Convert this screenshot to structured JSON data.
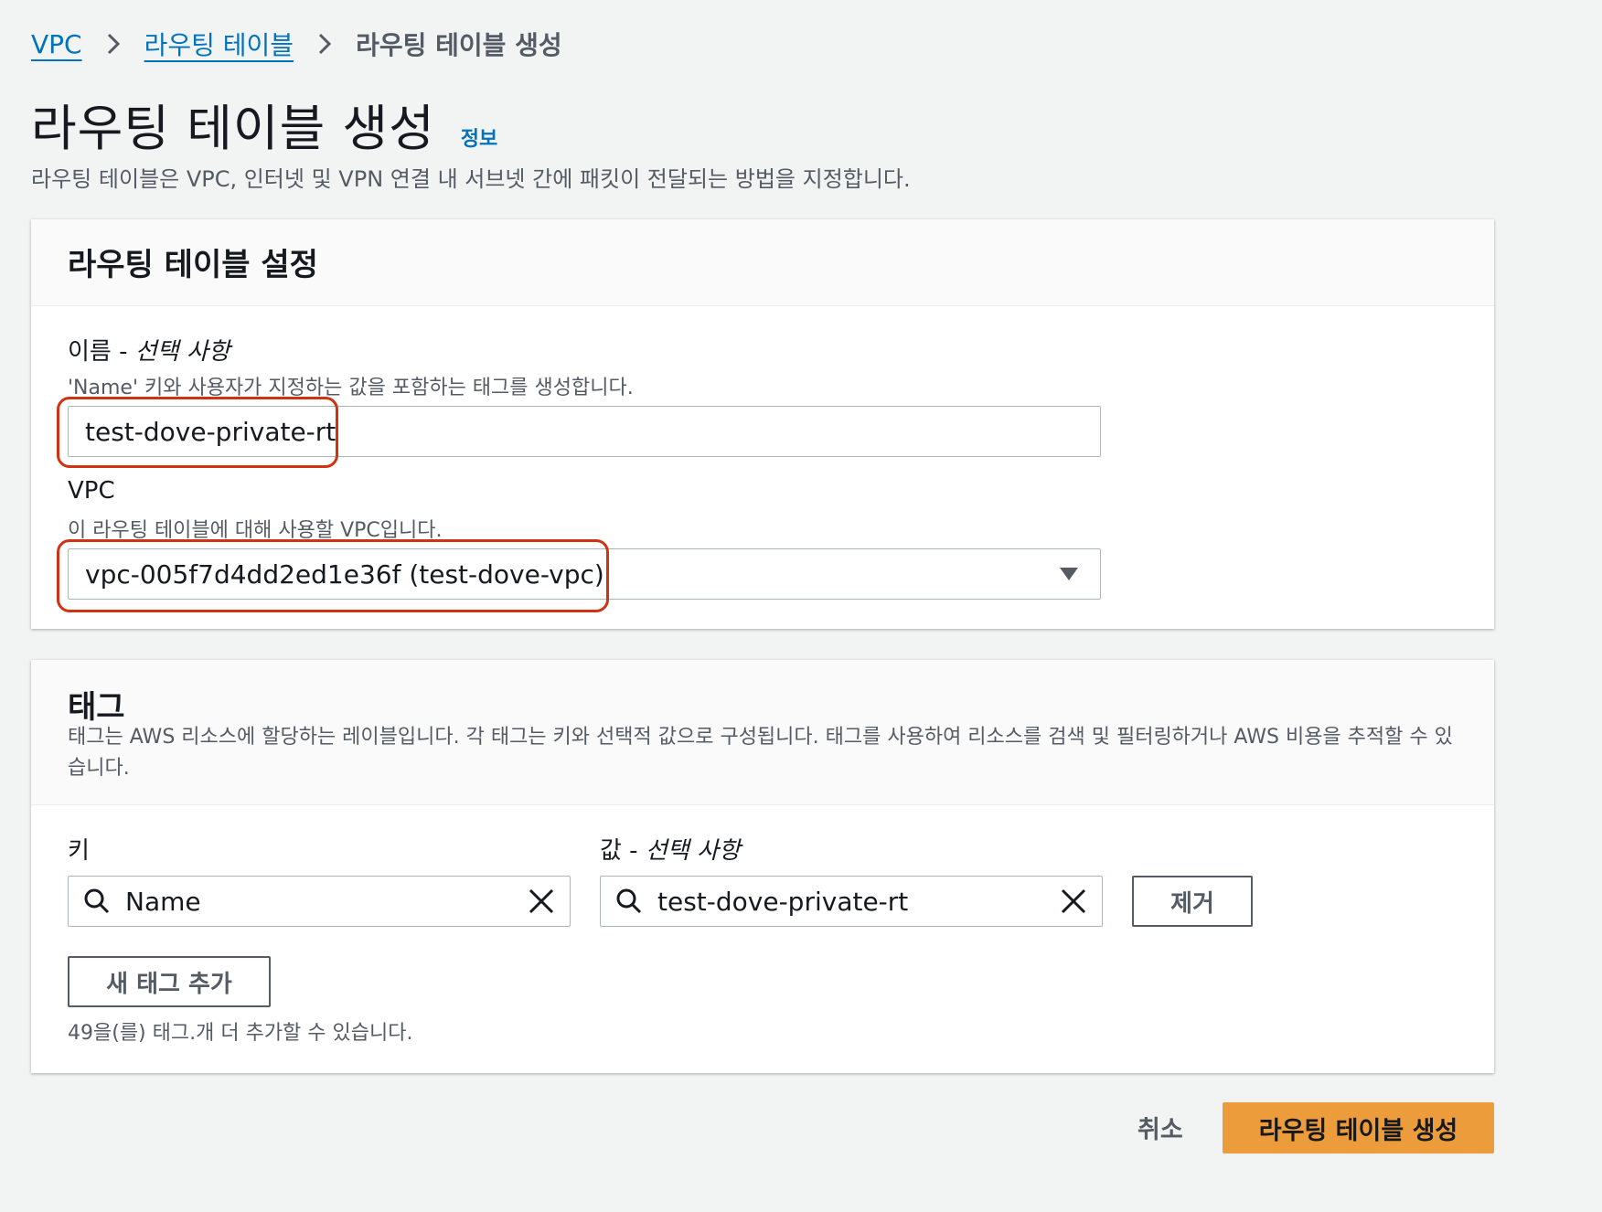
{
  "breadcrumb": {
    "items": [
      "VPC",
      "라우팅 테이블"
    ],
    "current": "라우팅 테이블 생성"
  },
  "page": {
    "title": "라우팅 테이블 생성",
    "info_link": "정보",
    "description": "라우팅 테이블은 VPC, 인터넷 및 VPN 연결 내 서브넷 간에 패킷이 전달되는 방법을 지정합니다."
  },
  "settings": {
    "title": "라우팅 테이블 설정",
    "name_label": "이름 - ",
    "name_optional": "선택 사항",
    "name_description": "'Name' 키와 사용자가 지정하는 값을 포함하는 태그를 생성합니다.",
    "name_value": "test-dove-private-rt",
    "vpc_label": "VPC",
    "vpc_description": "이 라우팅 테이블에 대해 사용할 VPC입니다.",
    "vpc_selected": "vpc-005f7d4dd2ed1e36f (test-dove-vpc)"
  },
  "tags": {
    "title": "태그",
    "description": "태그는 AWS 리소스에 할당하는 레이블입니다. 각 태그는 키와 선택적 값으로 구성됩니다. 태그를 사용하여 리소스를 검색 및 필터링하거나 AWS 비용을 추적할 수 있습니다.",
    "key_label": "키",
    "value_label": "값 - ",
    "value_optional": "선택 사항",
    "key_value": "Name",
    "value_value": "test-dove-private-rt",
    "remove_label": "제거",
    "add_label": "새 태그 추가",
    "remaining_note": "49을(를) 태그.개 더 추가할 수 있습니다."
  },
  "footer": {
    "cancel": "취소",
    "submit": "라우팅 테이블 생성"
  },
  "colors": {
    "link": "#0073bb",
    "primary": "#ec9c3a",
    "highlight": "#d13212"
  }
}
